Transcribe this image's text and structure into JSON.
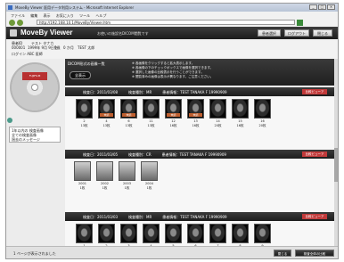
{
  "browser": {
    "title": "MoveBy Viewer 医用データ利用システム - Microsoft Internet Explorer",
    "menu": [
      "ファイル",
      "編集",
      "表示",
      "お気に入り",
      "ツール",
      "ヘルプ"
    ],
    "address": "http://192.168.10.1/MoveBy/Viewer.htm"
  },
  "app": {
    "title": "MoveBy Viewer",
    "subtitle": "お使いの施設名DICOM閲覧です",
    "buttons": {
      "search": "患者選択",
      "logout": "ログアウト",
      "close": "閉じる"
    }
  },
  "patient": {
    "id_label": "患者ID",
    "id": "000001",
    "name_kana": "テスト タナカ",
    "birth": "1999年 9月 9日生",
    "sex": "0歳",
    "age": "0 か月",
    "name": "TEST 太郎",
    "line3": "ログイン ABC 医師"
  },
  "sidebar": {
    "disc_label": "FUJIFILM",
    "links": [
      "1年以内の 検査画像",
      "全ての検査画像",
      "過去のメッセージ"
    ]
  },
  "banner": {
    "heading": "DICOM形式の画像一覧",
    "button": "全表示",
    "info": [
      "※ 各画像をクリックすると拡大表示します。",
      "※ 各画像の下のチェックボックスで画像を選択できます。",
      "※ 選択した画像の比較表示を行うことができます。",
      "※ 閲覧済みの画像は表示が異なります。ご注意ください。"
    ]
  },
  "studies": [
    {
      "header": "検査日：2011/03/08　　　検査種別：MR　　　患者情報：TEST TANAKA F 19990909",
      "button": "比較ビューア",
      "thumbs": [
        {
          "num": "2",
          "count": "13枚",
          "tag": ""
        },
        {
          "num": "4",
          "count": "13枚",
          "tag": "未読"
        },
        {
          "num": "6",
          "count": "13枚",
          "tag": "未読"
        },
        {
          "num": "11",
          "count": "13枚",
          "tag": ""
        },
        {
          "num": "12",
          "count": "16枚",
          "tag": "未読"
        },
        {
          "num": "13",
          "count": "16枚",
          "tag": "未読"
        },
        {
          "num": "14",
          "count": "20枚",
          "tag": ""
        },
        {
          "num": "15",
          "count": "16枚",
          "tag": ""
        },
        {
          "num": "16",
          "count": "20枚",
          "tag": ""
        }
      ]
    },
    {
      "header": "検査日：2011/03/05　　　検査種別：CR　　　患者情報：TEST TANAKA F 19990909",
      "button": "比較ビューア",
      "thumbs": [
        {
          "num": "2001",
          "count": "1枚",
          "tag": ""
        },
        {
          "num": "2002",
          "count": "1枚",
          "tag": ""
        },
        {
          "num": "2003",
          "count": "1枚",
          "tag": ""
        },
        {
          "num": "2004",
          "count": "1枚",
          "tag": ""
        }
      ]
    },
    {
      "header": "検査日：2011/03/03　　　検査種別：MR　　　患者情報：TEST TANAKA F 19990909",
      "button": "比較ビューア",
      "thumbs": [
        {
          "num": "1",
          "count": "",
          "tag": ""
        },
        {
          "num": "2",
          "count": "",
          "tag": ""
        },
        {
          "num": "3",
          "count": "",
          "tag": ""
        },
        {
          "num": "4",
          "count": "",
          "tag": ""
        },
        {
          "num": "5",
          "count": "",
          "tag": ""
        },
        {
          "num": "6",
          "count": "",
          "tag": ""
        },
        {
          "num": "7",
          "count": "",
          "tag": ""
        },
        {
          "num": "8",
          "count": "",
          "tag": ""
        },
        {
          "num": "9",
          "count": "",
          "tag": ""
        }
      ]
    }
  ],
  "status": {
    "text": "1 ページが表示されました",
    "buttons": [
      "閉じる",
      "検査全体の比較"
    ]
  }
}
